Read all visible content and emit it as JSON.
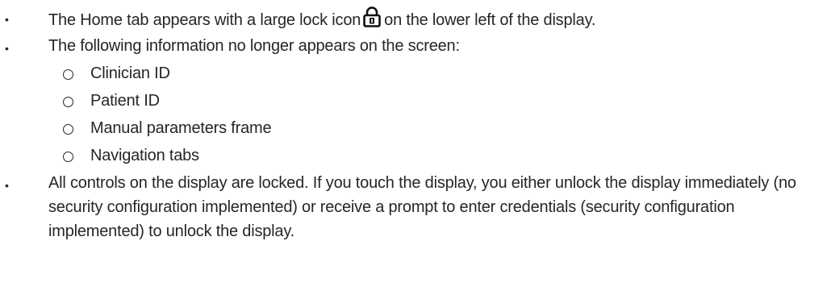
{
  "bullets": [
    {
      "pre": "The Home tab appears with a large lock icon",
      "icon": "lock-icon",
      "post": "on the lower left of the display."
    },
    {
      "text": "The following information no longer appears on the screen:"
    },
    {
      "text": "All controls on the display are locked. If you touch the display, you either unlock the display immediately (no security configuration implemented) or receive a prompt to enter credentials (security configuration implemented) to unlock the display."
    }
  ],
  "sub_items": [
    "Clinician ID",
    "Patient ID",
    "Manual parameters frame",
    "Navigation tabs"
  ]
}
